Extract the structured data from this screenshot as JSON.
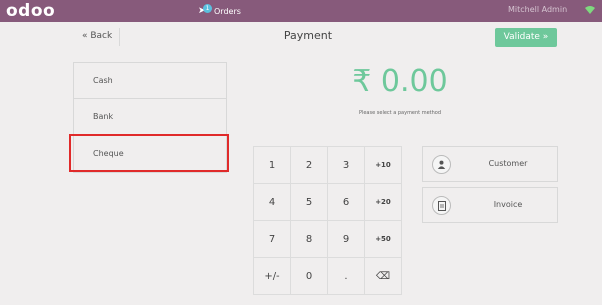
{
  "topbar": {
    "logo": "odoo",
    "orders_count": "1",
    "orders_label": "Orders",
    "user_name": "Mitchell Admin",
    "color": "#875a7b"
  },
  "header": {
    "back_label": "« Back",
    "title": "Payment",
    "validate_label": "Validate »"
  },
  "payment_methods": [
    {
      "label": "Cash"
    },
    {
      "label": "Bank"
    },
    {
      "label": "Cheque"
    }
  ],
  "amount": {
    "value": "₹ 0.00",
    "hint": "Please select a payment method",
    "color": "#6ec89b"
  },
  "numpad": {
    "keys": [
      "1",
      "2",
      "3",
      "+10",
      "4",
      "5",
      "6",
      "+20",
      "7",
      "8",
      "9",
      "+50",
      "+/-",
      "0",
      ".",
      "⌫"
    ]
  },
  "side_buttons": {
    "customer": {
      "label": "Customer",
      "icon": "user-icon"
    },
    "invoice": {
      "label": "Invoice",
      "icon": "document-icon"
    }
  }
}
